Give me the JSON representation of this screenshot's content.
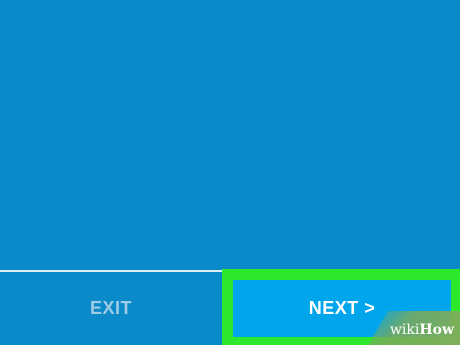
{
  "footer": {
    "exit_label": "EXIT",
    "next_label": "NEXT >"
  },
  "watermark": {
    "brand": "wikiHow"
  },
  "colors": {
    "background": "#0a8ac8",
    "highlight": "#2de82d",
    "next_button": "#00a5ec",
    "exit_text": "#9fcbe6"
  }
}
